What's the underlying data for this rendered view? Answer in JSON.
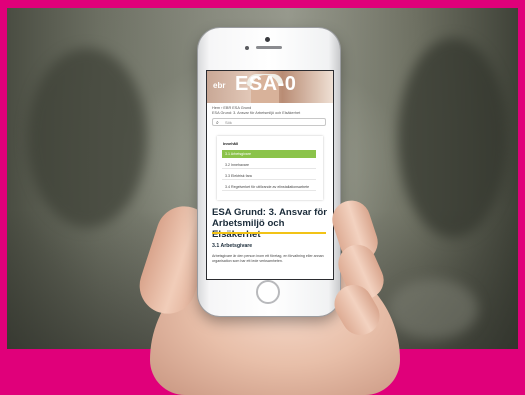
{
  "screen": {
    "hero": {
      "logo": "ebr",
      "title": "ESA-0"
    },
    "breadcrumb": "Hem › EBR ESA Grund\nESA Grund: 3. Ansvar för Arbetsmiljö och Elsäkerhet",
    "search": {
      "placeholder": "Sök"
    },
    "toc": {
      "title": "Innehåll",
      "items": [
        {
          "label": "3.1 Arbetsgivare",
          "active": true
        },
        {
          "label": "3.2 Innehavare",
          "active": false
        },
        {
          "label": "3.3 Elektrisk fara",
          "active": false
        },
        {
          "label": "3.4 Regelverket för utförande av elinstallationsarbete",
          "active": false
        }
      ]
    },
    "page_title": "ESA Grund: 3. Ansvar för Arbetsmiljö och Elsäkerhet",
    "section_heading": "3.1 Arbetsgivare",
    "body": "Arbetsgivare är den person inom ett företag, en förvaltning eller annan organisation som har ett lede verksamheten."
  },
  "colors": {
    "frame": "#e0007a",
    "active_item": "#8bc34a",
    "title_underline": "#f2c316"
  }
}
